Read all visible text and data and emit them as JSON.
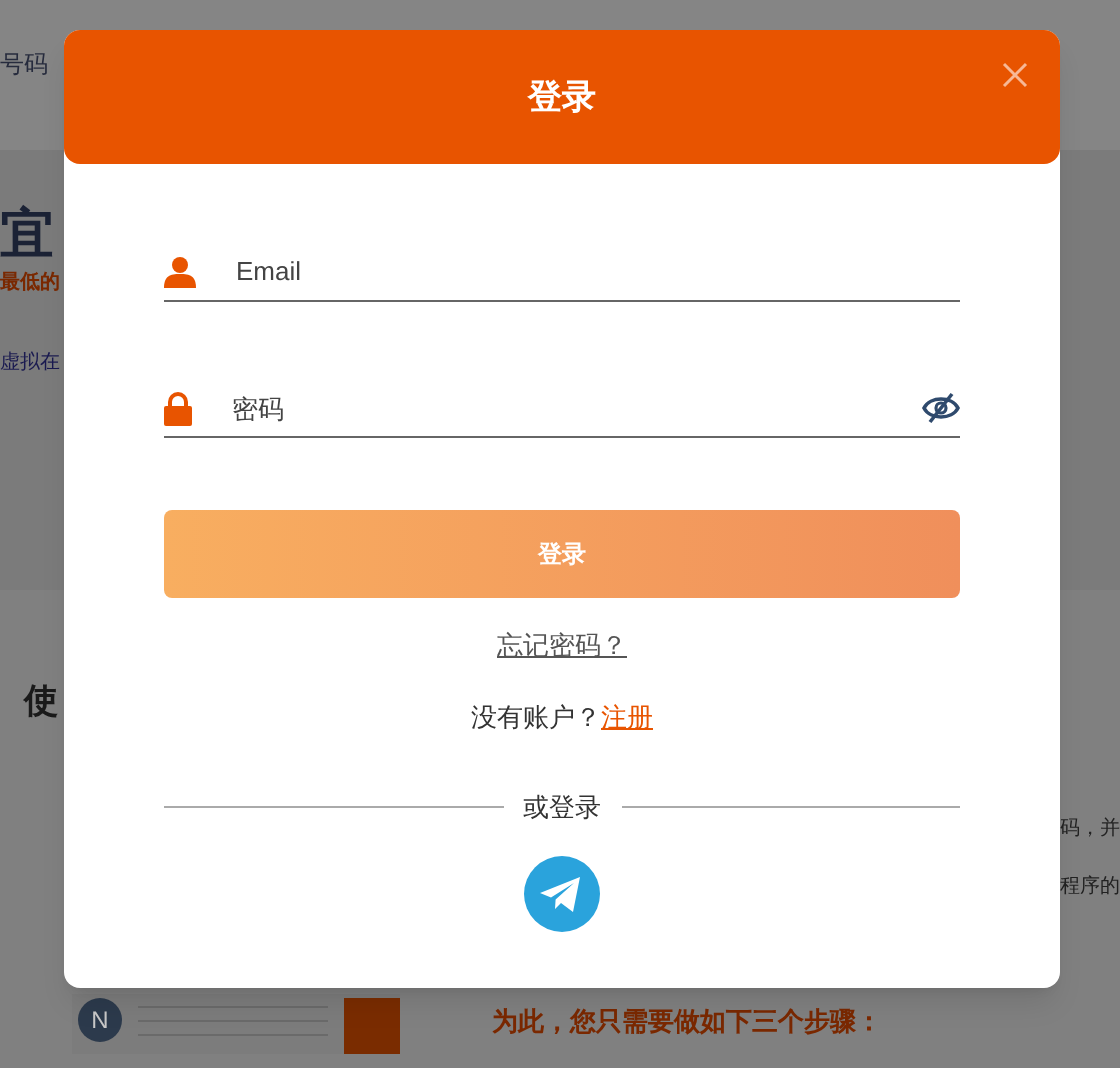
{
  "background": {
    "header_text": "号码",
    "headline": "宜",
    "subheadline": "最低的",
    "intro_line": "虚拟在",
    "section_title": "使",
    "right_lines": [
      "码，并",
      "程序的"
    ],
    "steps_heading": "为此，您只需要做如下三个步骤：",
    "avatar_letter": "N"
  },
  "dialog": {
    "title": "登录",
    "fields": [
      {
        "kind": "email",
        "placeholder": "Email"
      },
      {
        "kind": "password",
        "placeholder": "密码"
      }
    ],
    "submit": "登录",
    "forgot": "忘记密码？",
    "signup_prompt": "没有账户？",
    "signup_link": "注册",
    "divider": "或登录"
  }
}
